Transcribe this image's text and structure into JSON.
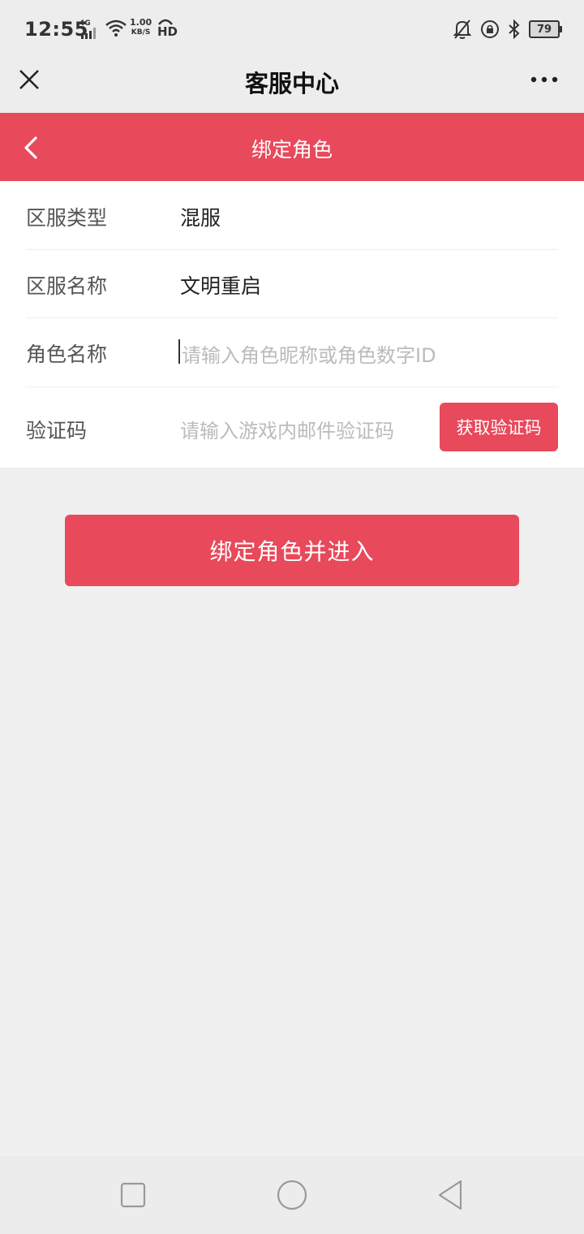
{
  "status_bar": {
    "time": "12:55",
    "network": "4G",
    "speed_value": "1.00",
    "speed_unit": "KB/S",
    "hd": "HD",
    "battery": "79"
  },
  "title_bar": {
    "title": "客服中心"
  },
  "header": {
    "title": "绑定角色"
  },
  "form": {
    "server_type_label": "区服类型",
    "server_type_value": "混服",
    "server_name_label": "区服名称",
    "server_name_value": "文明重启",
    "role_name_label": "角色名称",
    "role_name_placeholder": "请输入角色昵称或角色数字ID",
    "code_label": "验证码",
    "code_placeholder": "请输入游戏内邮件验证码",
    "get_code_label": "获取验证码"
  },
  "submit_label": "绑定角色并进入",
  "colors": {
    "accent": "#e8495b",
    "background": "#f0f0f0"
  }
}
